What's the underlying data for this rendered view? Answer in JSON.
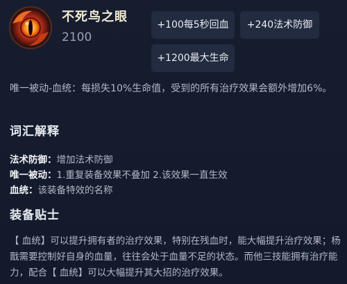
{
  "item": {
    "name": "不死鸟之眼",
    "price": "2100",
    "icon": "phoenix-eye-icon"
  },
  "stats": [
    "+100每5秒回血",
    "+240法术防御",
    "+1200最大生命"
  ],
  "passive": "唯一被动-血统：每损失10%生命值，受到的所有治疗效果会额外增加6%。",
  "glossary": {
    "title": "词汇解释",
    "entries": [
      {
        "term": "法术防御：",
        "desc": "增加法术防御"
      },
      {
        "term": "唯一被动：",
        "desc": "1.重复装备效果不叠加 2.该效果一直生效"
      },
      {
        "term": "血统：",
        "desc": "该装备特效的名称"
      }
    ]
  },
  "tips": {
    "title": "装备贴士",
    "text": "【 血统】可以提升拥有者的治疗效果，特别在残血时，能大幅提升治疗效果；杨戬需要控制好自身的血量，往往会处于血量不足的状态。而他三技能拥有治疗能力，配合【 血统】可以大幅提升其大招的治疗效果。"
  },
  "colors": {
    "background": "#141b2c",
    "chip": "#222b3f",
    "title": "#f2ead4",
    "body_text": "#b2b8c6"
  }
}
